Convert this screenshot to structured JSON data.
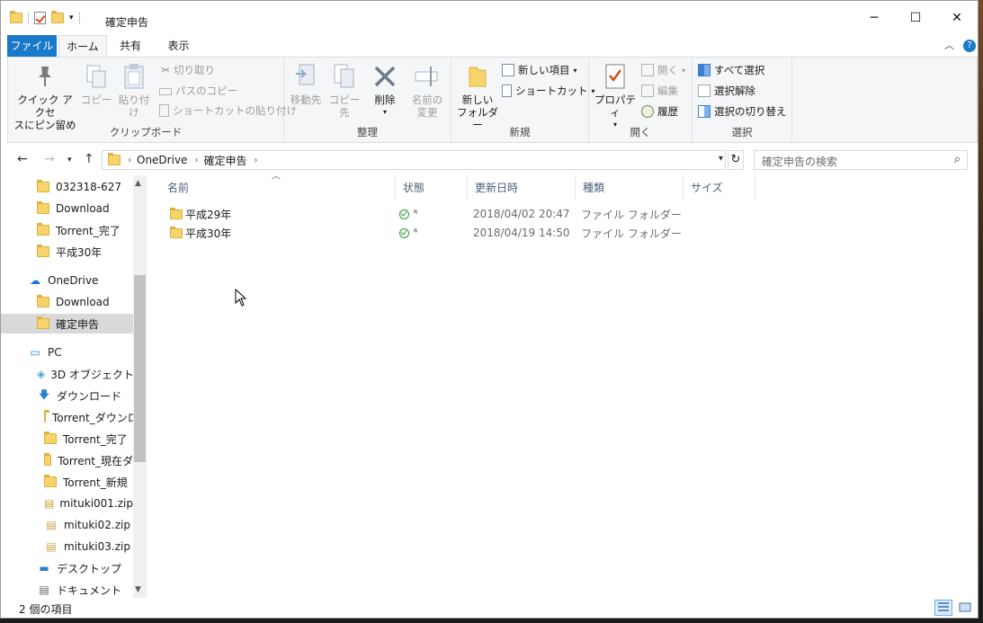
{
  "window": {
    "title": "確定申告",
    "controls": {
      "minimize": "─",
      "maximize": "☐",
      "close": "✕"
    }
  },
  "ribbon_tabs": [
    "ファイル",
    "ホーム",
    "共有",
    "表示"
  ],
  "ribbon": {
    "clipboard": {
      "label": "クリップボード",
      "pin": "クイック アクセス\nにピン留め",
      "pin_l1": "クイック アクセ",
      "pin_l2": "スにピン留め",
      "copy": "コピー",
      "paste": "貼り付け",
      "cut": "切り取り",
      "copy_path": "パスのコピー",
      "paste_shortcut": "ショートカットの貼り付け"
    },
    "organize": {
      "label": "整理",
      "move_to": "移動先",
      "copy_to": "コピー先",
      "delete": "削除",
      "rename_l1": "名前の",
      "rename_l2": "変更"
    },
    "new": {
      "label": "新規",
      "new_folder_l1": "新しい",
      "new_folder_l2": "フォルダー",
      "new_item": "新しい項目",
      "shortcut": "ショートカット"
    },
    "open": {
      "label": "開く",
      "properties": "プロパティ",
      "open": "開く",
      "edit": "編集",
      "history": "履歴"
    },
    "select": {
      "label": "選択",
      "select_all": "すべて選択",
      "select_none": "選択解除",
      "invert": "選択の切り替え"
    }
  },
  "address": {
    "crumbs": [
      "OneDrive",
      "確定申告"
    ],
    "search_placeholder": "確定申告の検索"
  },
  "nav_pane": {
    "items": [
      {
        "label": "032318-627",
        "indent": 1,
        "icon": "folder-icon"
      },
      {
        "label": "Download",
        "indent": 1,
        "icon": "folder-icon"
      },
      {
        "label": "Torrent_完了",
        "indent": 1,
        "icon": "folder-icon"
      },
      {
        "label": "平成30年",
        "indent": 1,
        "icon": "folder-icon"
      },
      {
        "label": "OneDrive",
        "indent": 0,
        "icon": "cloud-icon"
      },
      {
        "label": "Download",
        "indent": 1,
        "icon": "folder-icon"
      },
      {
        "label": "確定申告",
        "indent": 1,
        "icon": "folder-icon",
        "selected": true
      },
      {
        "label": "PC",
        "indent": 0,
        "icon": "pc-icon"
      },
      {
        "label": "3D オブジェクト",
        "indent": 1,
        "icon": "cube-icon"
      },
      {
        "label": "ダウンロード",
        "indent": 1,
        "icon": "download-arrow-icon"
      },
      {
        "label": "Torrent_ダウンロ",
        "indent": 2,
        "icon": "folder-icon"
      },
      {
        "label": "Torrent_完了",
        "indent": 2,
        "icon": "folder-icon"
      },
      {
        "label": "Torrent_現在ダ",
        "indent": 2,
        "icon": "folder-icon"
      },
      {
        "label": "Torrent_新規",
        "indent": 2,
        "icon": "folder-icon"
      },
      {
        "label": "mituki001.zip",
        "indent": 2,
        "icon": "zip-icon"
      },
      {
        "label": "mituki02.zip",
        "indent": 2,
        "icon": "zip-icon"
      },
      {
        "label": "mituki03.zip",
        "indent": 2,
        "icon": "zip-icon"
      },
      {
        "label": "デスクトップ",
        "indent": 1,
        "icon": "desktop-icon"
      },
      {
        "label": "ドキュメント",
        "indent": 1,
        "icon": "document-icon"
      }
    ]
  },
  "columns": [
    "名前",
    "状態",
    "更新日時",
    "種類",
    "サイズ"
  ],
  "files": [
    {
      "name": "平成29年",
      "date": "2018/04/02 20:47",
      "type": "ファイル フォルダー",
      "size": ""
    },
    {
      "name": "平成30年",
      "date": "2018/04/19 14:50",
      "type": "ファイル フォルダー",
      "size": ""
    }
  ],
  "status": {
    "item_count": "2 個の項目"
  },
  "colors": {
    "accent": "#1979ca",
    "folder": "#f6d36b",
    "selected_nav": "#d9d9d9"
  }
}
